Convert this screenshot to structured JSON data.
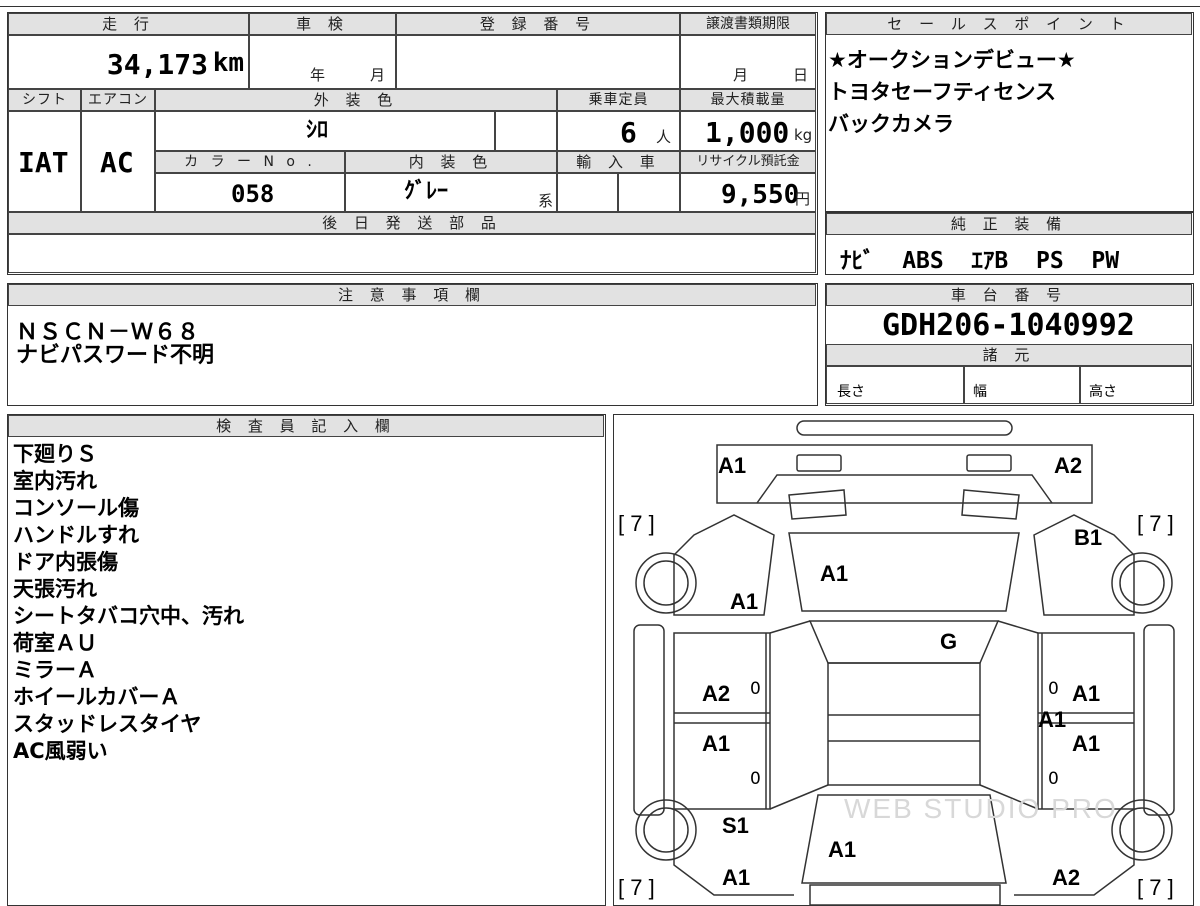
{
  "vehicle": {
    "headers": {
      "mileage": "走 行",
      "inspection": "車 検",
      "registration_no": "登 録 番 号",
      "transfer_deadline": "譲渡書類期限",
      "shift": "シフト",
      "aircon": "エアコン",
      "exterior_color": "外 装 色",
      "capacity": "乗車定員",
      "max_load": "最大積載量",
      "color_no": "カ ラ ー N o .",
      "interior_color": "内 装 色",
      "import": "輸 入 車",
      "recycle_fee": "リサイクル預託金",
      "later_parts": "後 日 発 送 部 品"
    },
    "mileage": "34,173",
    "mileage_unit": "km",
    "inspection_year": "年",
    "inspection_month": "月",
    "deadline_month": "月",
    "deadline_day": "日",
    "shift": "IAT",
    "aircon": "AC",
    "exterior_color": "ｼﾛ",
    "capacity": "6",
    "capacity_unit": "人",
    "max_load": "1,000",
    "max_load_unit": "kg",
    "color_no": "058",
    "interior_color": "ｸﾞﾚｰ",
    "interior_suffix": "系",
    "recycle_fee": "9,550",
    "recycle_unit": "円"
  },
  "sales_point": {
    "header": "セ ー ル ス ポ イ ン ト",
    "lines": [
      "★オークションデビュー★",
      "トヨタセーフティセンス",
      "バックカメラ"
    ]
  },
  "genuine_equipment": {
    "header": "純 正 装 備",
    "value": "ﾅﾋﾞ  ABS  ｴｱB  PS  PW"
  },
  "notes": {
    "header": "注 意 事 項 欄",
    "lines": [
      "ＮＳＣＮ－Ｗ６８",
      "ナビパスワード不明"
    ]
  },
  "chassis": {
    "header": "車 台 番 号",
    "value": "GDH206-1040992",
    "specs_header": "諸 元",
    "length": "長さ",
    "width": "幅",
    "height": "高さ"
  },
  "inspector": {
    "header": "検 査 員 記 入 欄",
    "lines": [
      "下廻りＳ",
      "室内汚れ",
      "コンソール傷",
      "ハンドルすれ",
      "ドア内張傷",
      "天張汚れ",
      "シートタバコ穴中、汚れ",
      "荷室ＡＵ",
      "ミラーＡ",
      "ホイールカバーＡ",
      "スタッドレスタイヤ",
      "AC風弱い"
    ]
  },
  "diagram": {
    "front_left": "A1",
    "front_right": "A2",
    "fender_right": "B1",
    "hood": "A1",
    "fender_left": "A1",
    "windshield": "G",
    "door_fl": "A2",
    "door_fr": "A1",
    "pillar_right": "A1",
    "door_rl": "A1",
    "door_rr": "A1",
    "quarter_left": "S1",
    "roof_rear": "A1",
    "rear_left": "A1",
    "rear_right": "A2",
    "tire_fl": "[ 7 ]",
    "tire_fr": "[ 7 ]",
    "tire_rl": "[ 7 ]",
    "tire_rr": "[ 7 ]",
    "zero": "0",
    "watermark": "WEB STUDIO PRO"
  }
}
